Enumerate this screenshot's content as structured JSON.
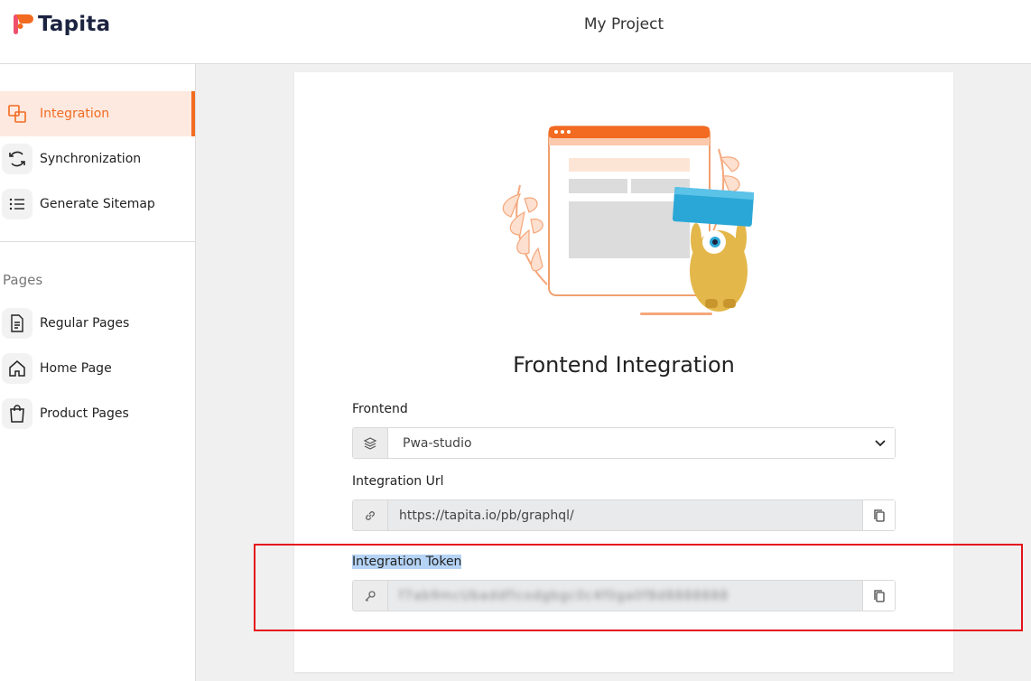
{
  "brand": {
    "name": "Tapita",
    "accent_color": "#f26b21",
    "logo_icon": "tapita-logo-icon"
  },
  "header": {
    "title": "My Project"
  },
  "sidebar": {
    "items": [
      {
        "label": "Integration",
        "icon": "integration-icon",
        "active": true
      },
      {
        "label": "Synchronization",
        "icon": "sync-icon",
        "active": false
      },
      {
        "label": "Generate Sitemap",
        "icon": "list-icon",
        "active": false
      }
    ],
    "pages_section_label": "Pages",
    "pages": [
      {
        "label": "Regular Pages",
        "icon": "document-icon"
      },
      {
        "label": "Home Page",
        "icon": "home-icon"
      },
      {
        "label": "Product Pages",
        "icon": "shopping-bag-icon"
      }
    ]
  },
  "card": {
    "title": "Frontend Integration",
    "frontend": {
      "label": "Frontend",
      "selected": "Pwa-studio",
      "icon": "layers-icon"
    },
    "integration_url": {
      "label": "Integration Url",
      "value": "https://tapita.io/pb/graphql/",
      "icon": "link-icon",
      "copy_icon": "copy-icon"
    },
    "integration_token": {
      "label": "Integration Token",
      "value": "f7ab9mcUbaddflcodgbgc0c4f0ga0f8d8888888",
      "icon": "key-icon",
      "copy_icon": "copy-icon"
    }
  },
  "annotation": {
    "color": "#e4121b"
  }
}
